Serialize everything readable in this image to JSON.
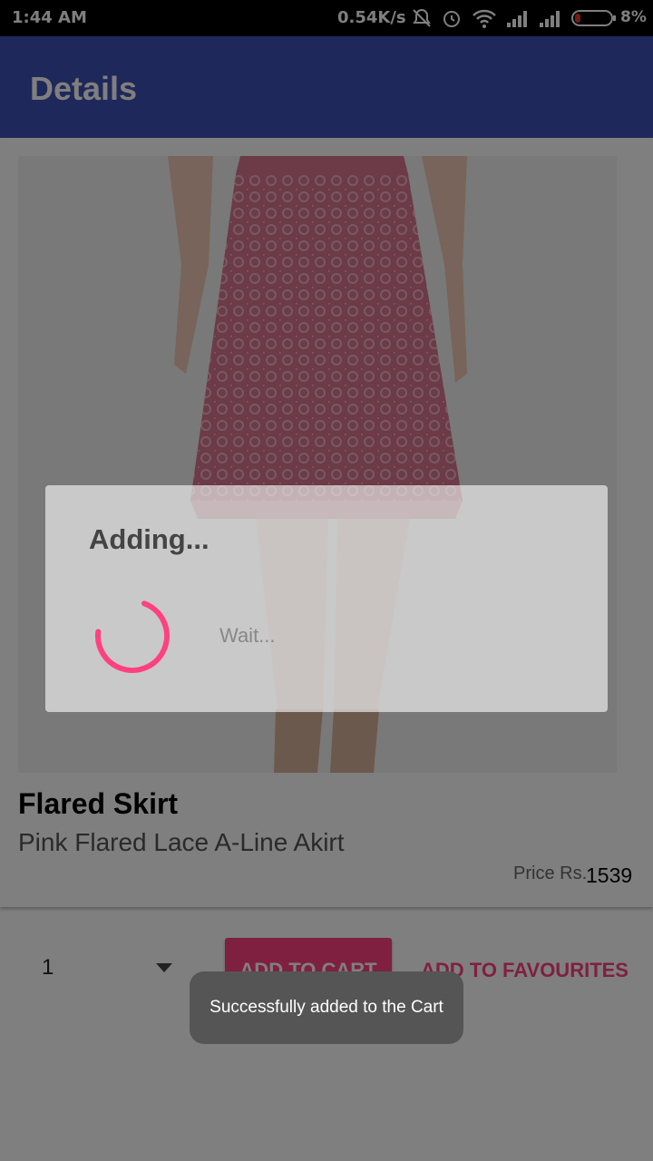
{
  "status_bar": {
    "time": "1:44 AM",
    "network_speed": "0.54K/s",
    "battery_percent": "8%",
    "icons": [
      "mute-icon",
      "alarm-icon",
      "wifi-icon",
      "signal-icon",
      "signal-icon",
      "battery-icon"
    ]
  },
  "app_bar": {
    "title": "Details",
    "color": "#3f51b5"
  },
  "product": {
    "image_icon": "skirt-photo",
    "name": "Flared Skirt",
    "description": "Pink Flared Lace A-Line Akirt",
    "price_label": "Price Rs.",
    "price": "1539"
  },
  "actions": {
    "quantity": "1",
    "add_to_cart_label": "ADD TO CART",
    "add_to_favourites_label": "ADD TO FAVOURITES",
    "accent_color": "#ff4081"
  },
  "dialog": {
    "title": "Adding...",
    "message": "Wait..."
  },
  "toast": {
    "message": "Successfully added to the Cart"
  }
}
